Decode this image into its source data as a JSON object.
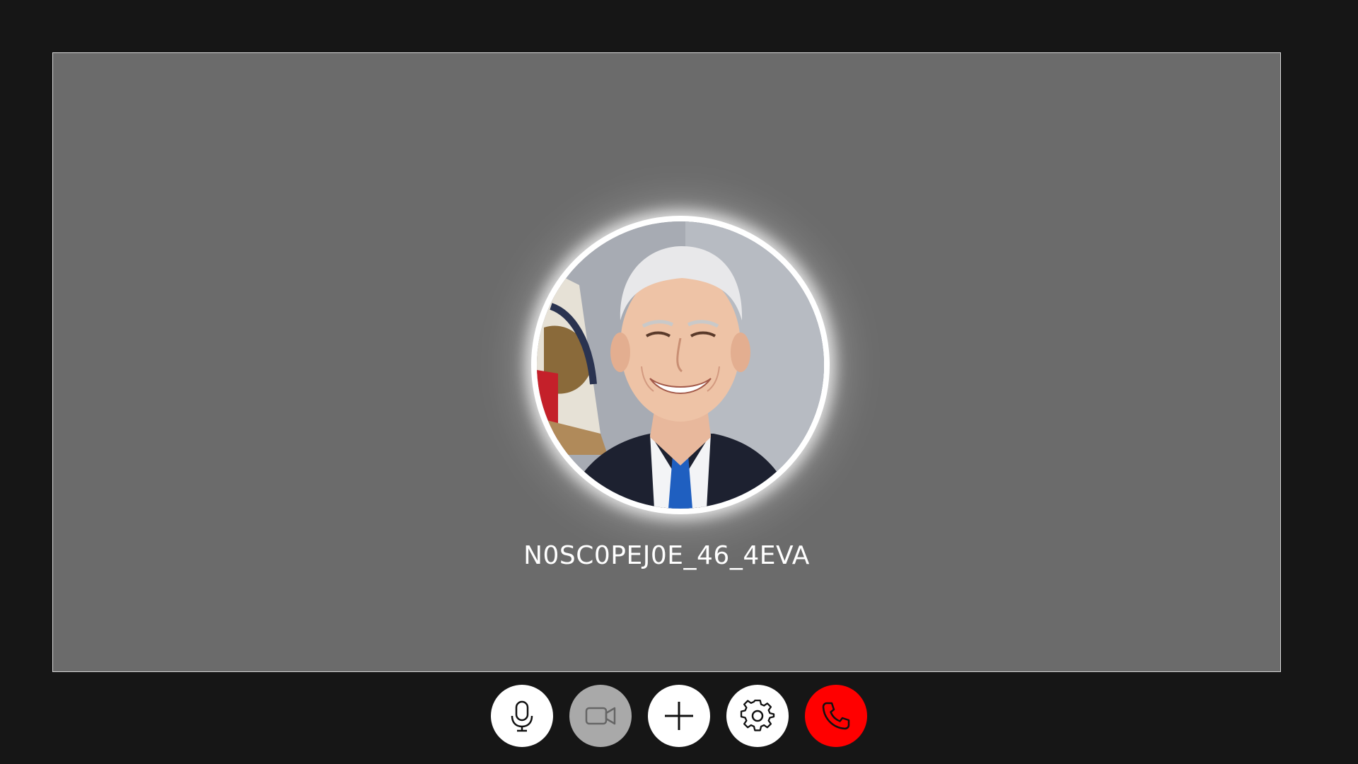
{
  "call": {
    "participant_name": "N0SC0PEJ0E_46_4EVA",
    "avatar_icon": "participant-photo"
  },
  "controls": [
    {
      "name": "microphone-button",
      "icon": "microphone-icon",
      "state": "on"
    },
    {
      "name": "camera-button",
      "icon": "video-camera-icon",
      "state": "off"
    },
    {
      "name": "add-participant-button",
      "icon": "plus-icon",
      "state": "on"
    },
    {
      "name": "settings-button",
      "icon": "gear-icon",
      "state": "on"
    },
    {
      "name": "end-call-button",
      "icon": "phone-icon",
      "state": "end"
    }
  ],
  "colors": {
    "background": "#161616",
    "stage": "#6b6b6b",
    "end_call": "#ff0000",
    "disabled": "#a9a9a9"
  }
}
